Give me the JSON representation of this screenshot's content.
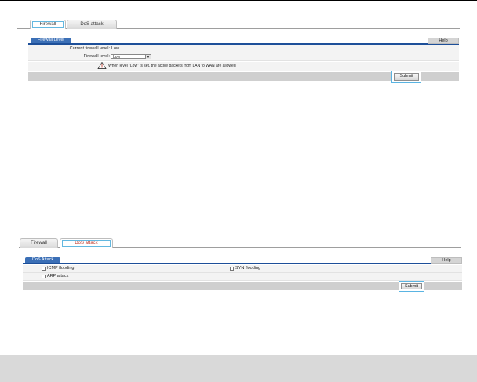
{
  "section1": {
    "tabs": [
      {
        "label": "Firewall",
        "active": true
      },
      {
        "label": "DoS attack",
        "active": false
      }
    ],
    "panel_title": "Firewall Level",
    "help_label": "Help",
    "current_level_label": "Current firewall level:",
    "current_level_value": "Low",
    "level_select_label": "Firewall level:",
    "level_select_value": "Low",
    "warning_text": "When level \"Low\" is set, the active packets from LAN to WAN are allowed",
    "submit_label": "Submit"
  },
  "section2": {
    "tabs": [
      {
        "label": "Firewall",
        "active": false
      },
      {
        "label": "DoS attack",
        "active": true
      }
    ],
    "panel_title": "DoS Attack",
    "help_label": "Help",
    "checkboxes": [
      {
        "label": "ICMP flooding",
        "checked": false
      },
      {
        "label": "SYN flooding",
        "checked": false
      },
      {
        "label": "ARP attack",
        "checked": false
      }
    ],
    "submit_label": "Submit"
  },
  "colors": {
    "panel_header": "#3b6fb6",
    "panel_rule": "#1d4f99",
    "highlight": "#63b8e0",
    "footer_bar": "#cfcfcf",
    "active_tab_text": "#c0392b"
  },
  "icons": [
    "warning-triangle-icon",
    "chevron-down-icon"
  ]
}
